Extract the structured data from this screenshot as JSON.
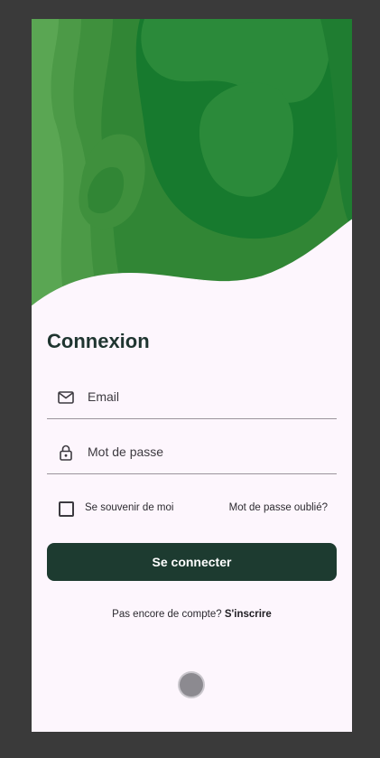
{
  "login": {
    "title": "Connexion",
    "email_placeholder": "Email",
    "password_placeholder": "Mot de passe",
    "remember_label": "Se souvenir de moi",
    "forgot_label": "Mot de passe oublié?",
    "submit_label": "Se connecter",
    "signup_prompt": "Pas encore de compte?",
    "signup_label": "S'inscrire"
  },
  "icons": {
    "email": "mail-icon",
    "password": "lock-icon",
    "remember": "checkbox-unchecked"
  },
  "colors": {
    "background": "#fdf6fd",
    "primary_button": "#1d3b30",
    "title_text": "#1f3530",
    "hero_green_dark": "#177a2e",
    "hero_green_light": "#5aa653"
  }
}
